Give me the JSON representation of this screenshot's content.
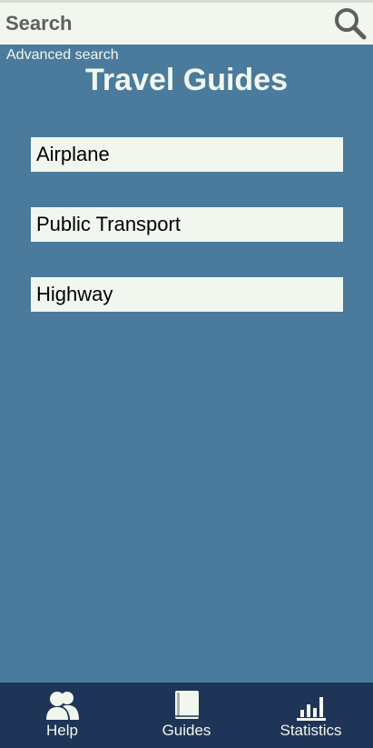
{
  "search": {
    "placeholder": "Search",
    "value": "",
    "icon": "search-icon"
  },
  "advanced_search_label": "Advanced search",
  "title": "Travel Guides",
  "guides": [
    {
      "label": "Airplane"
    },
    {
      "label": "Public Transport"
    },
    {
      "label": "Highway"
    }
  ],
  "nav": {
    "items": [
      {
        "label": "Help",
        "icon": "person-icon"
      },
      {
        "label": "Guides",
        "icon": "book-icon"
      },
      {
        "label": "Statistics",
        "icon": "bar-chart-icon"
      }
    ]
  },
  "colors": {
    "background": "#4a7b9d",
    "surface": "#f1f7ee",
    "nav_background": "#1f3557",
    "text_light": "#f1f7ee",
    "search_text": "#5f5f5f"
  }
}
